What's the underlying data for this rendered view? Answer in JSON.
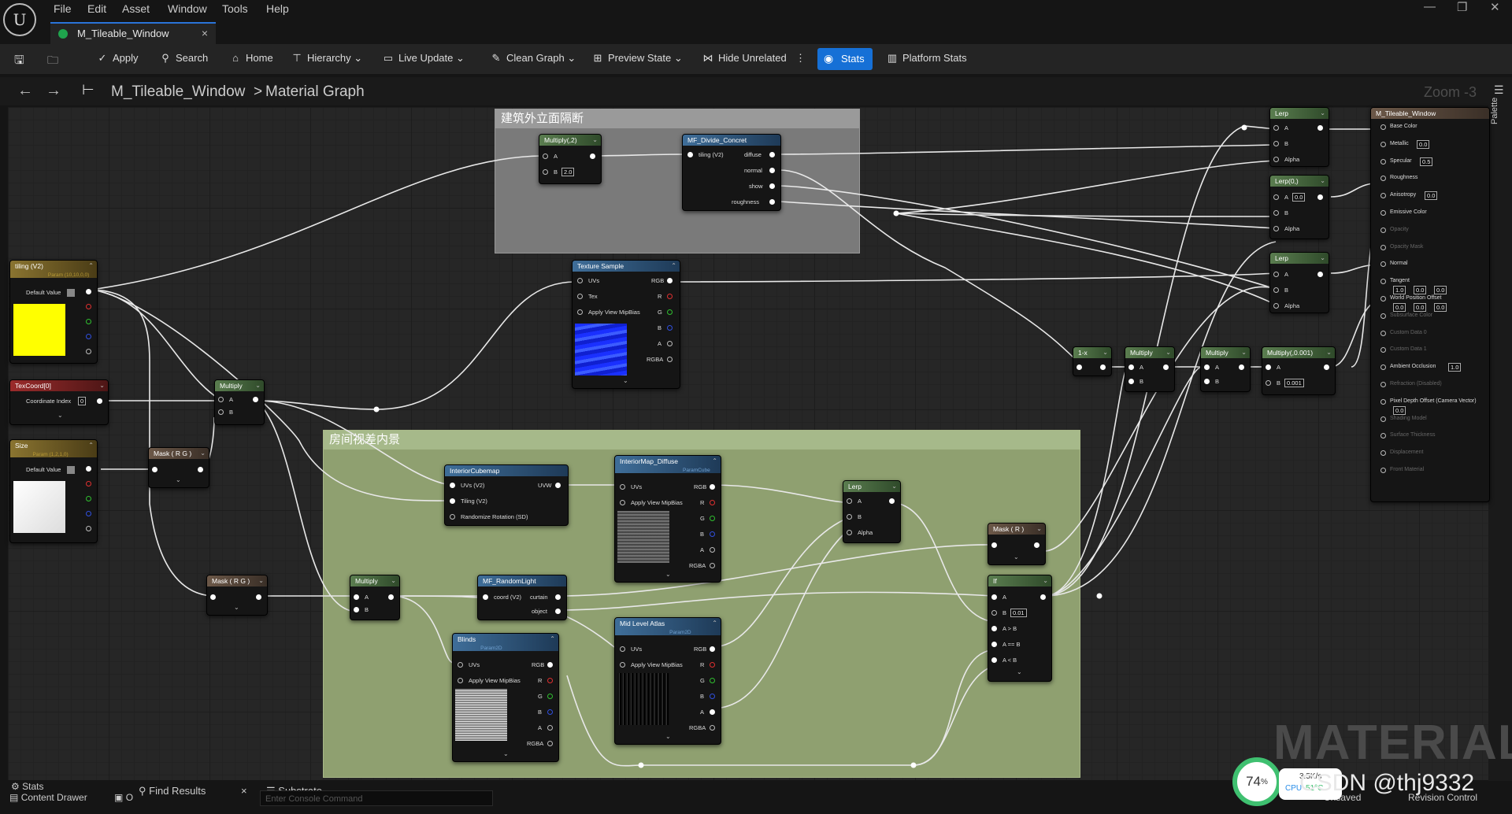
{
  "menu": [
    "File",
    "Edit",
    "Asset",
    "Window",
    "Tools",
    "Help"
  ],
  "tab": {
    "title": "M_Tileable_Window",
    "close": "×"
  },
  "window_controls": {
    "minimize": "—",
    "restore": "❐",
    "close": "✕"
  },
  "toolbar": {
    "apply": "Apply",
    "search": "Search",
    "home": "Home",
    "hierarchy": "Hierarchy",
    "live_update": "Live Update",
    "clean_graph": "Clean Graph",
    "preview_state": "Preview State",
    "hide_unrelated": "Hide Unrelated",
    "stats": "Stats",
    "platform_stats": "Platform Stats"
  },
  "breadcrumb": {
    "root": "M_Tileable_Window",
    "sep": ">",
    "current": "Material Graph"
  },
  "zoom": "Zoom -3",
  "palette": "Palette",
  "comments": {
    "facade": "建筑外立面隔断",
    "interior": "房间视差内景"
  },
  "nodes": {
    "tiling": {
      "title": "tiling (V2)",
      "sub": "Param (10,10,0,0)",
      "default": "Default Value"
    },
    "texcoord": {
      "title": "TexCoord[0]",
      "coord": "Coordinate Index",
      "coord_val": "0"
    },
    "size": {
      "title": "Size",
      "sub": "Param (1,2,1,0)",
      "default": "Default Value"
    },
    "multiply_top": {
      "title": "Multiply",
      "a": "A",
      "b": "B"
    },
    "mask_rg1": {
      "title": "Mask ( R G )"
    },
    "mask_rg2": {
      "title": "Mask ( R G )"
    },
    "multiply2": {
      "title": "Multiply(,2)",
      "a": "A",
      "b": "B",
      "b_val": "2.0"
    },
    "mf_divide": {
      "title": "MF_Divide_Concret",
      "in": "tiling (V2)",
      "outs": [
        "diffuse",
        "normal",
        "show",
        "roughness"
      ]
    },
    "texture_sample": {
      "title": "Texture Sample",
      "pins": [
        "UVs",
        "Tex",
        "Apply View MipBias"
      ],
      "outs": [
        "RGB",
        "R",
        "G",
        "B",
        "A",
        "RGBA"
      ]
    },
    "interior_cubemap": {
      "title": "InteriorCubemap",
      "pins": [
        "UVs (V2)",
        "Tiling (V2)",
        "Randomize Rotation (SD)"
      ],
      "out": "UVW"
    },
    "interior_diffuse": {
      "title": "InteriorMap_Diffuse",
      "sub": "ParamCube",
      "pins": [
        "UVs",
        "Apply View MipBias"
      ],
      "outs": [
        "RGB",
        "R",
        "G",
        "B",
        "A",
        "RGBA"
      ]
    },
    "multiply_mid": {
      "title": "Multiply",
      "a": "A",
      "b": "B"
    },
    "mf_random": {
      "title": "MF_RandomLight",
      "in": "coord (V2)",
      "outs": [
        "curtain",
        "object"
      ]
    },
    "blinds": {
      "title": "Blinds",
      "sub": "Param2D",
      "pins": [
        "UVs",
        "Apply View MipBias"
      ],
      "outs": [
        "RGB",
        "R",
        "G",
        "B",
        "A",
        "RGBA"
      ]
    },
    "mid_atlas": {
      "title": "Mid Level Atlas",
      "sub": "Param2D",
      "pins": [
        "UVs",
        "Apply View MipBias"
      ],
      "outs": [
        "RGB",
        "R",
        "G",
        "B",
        "A",
        "RGBA"
      ]
    },
    "lerp_mid": {
      "title": "Lerp",
      "pins": [
        "A",
        "B",
        "Alpha"
      ]
    },
    "mask_r": {
      "title": "Mask ( R )"
    },
    "if_node": {
      "title": "If",
      "pins": [
        "A",
        "B",
        "A > B",
        "A == B",
        "A < B"
      ],
      "b_val": "0.01"
    },
    "one_minus": {
      "title": "1-x"
    },
    "mult_r1": {
      "title": "Multiply",
      "a": "A",
      "b": "B"
    },
    "mult_r2": {
      "title": "Multiply",
      "a": "A",
      "b": "B"
    },
    "mult_r3": {
      "title": "Multiply(,0.001)",
      "a": "A",
      "b": "B",
      "b_val": "0.001"
    },
    "lerp1": {
      "title": "Lerp",
      "pins": [
        "A",
        "B",
        "Alpha"
      ]
    },
    "lerp2": {
      "title": "Lerp(0,)",
      "pins": [
        "A",
        "B",
        "Alpha"
      ],
      "a_val": "0.0"
    },
    "lerp3": {
      "title": "Lerp",
      "pins": [
        "A",
        "B",
        "Alpha"
      ]
    },
    "output": {
      "title": "M_Tileable_Window",
      "pins": [
        {
          "label": "Base Color"
        },
        {
          "label": "Metallic",
          "val": "0.0"
        },
        {
          "label": "Specular",
          "val": "0.5"
        },
        {
          "label": "Roughness"
        },
        {
          "label": "Anisotropy",
          "val": "0.0"
        },
        {
          "label": "Emissive Color"
        },
        {
          "label": "Opacity",
          "dim": true
        },
        {
          "label": "Opacity Mask",
          "dim": true
        },
        {
          "label": "Normal"
        },
        {
          "label": "Tangent"
        },
        {
          "label": "World Position Offset"
        },
        {
          "label": "Subsurface Color",
          "dim": true
        },
        {
          "label": "Custom Data 0",
          "dim": true
        },
        {
          "label": "Custom Data 1",
          "dim": true
        },
        {
          "label": "Ambient Occlusion",
          "val": "1.0"
        },
        {
          "label": "Refraction (Disabled)",
          "dim": true
        },
        {
          "label": "Pixel Depth Offset (Camera Vector)"
        },
        {
          "label": "Shading Model",
          "dim": true
        },
        {
          "label": "Surface Thickness",
          "dim": true
        },
        {
          "label": "Displacement",
          "dim": true
        },
        {
          "label": "Front Material",
          "dim": true
        }
      ],
      "tangent": {
        "x": "1.0",
        "y": "0.0",
        "z": "0.0"
      },
      "wpo": {
        "x": "0.0",
        "y": "0.0",
        "z": "0.0"
      },
      "pdo_val": "0.0"
    }
  },
  "watermark": "MATERIAL",
  "status": {
    "stats": "Stats",
    "content_drawer": "Content Drawer",
    "output_log": "O",
    "find_results": "Find Results",
    "find_close": "×",
    "substrate": "Substrate",
    "console_placeholder": "Enter Console Command",
    "unsaved": "Unsaved",
    "revision": "Revision Control"
  },
  "cpu": {
    "percent": "74",
    "unit": "%",
    "speed": "3.5K/s",
    "label": "CPU",
    "temp": "51°C"
  },
  "overlay_text": "CSDN @thj9332",
  "colors": {
    "accent": "#1670d6",
    "facade_comment": "#7a7a7a",
    "interior_comment": "#8fa070",
    "tiling_preview": "#ffff00",
    "size_preview": "#ffffff",
    "pin_red": "#e03030",
    "pin_green": "#30c030",
    "pin_blue": "#3050e0"
  }
}
